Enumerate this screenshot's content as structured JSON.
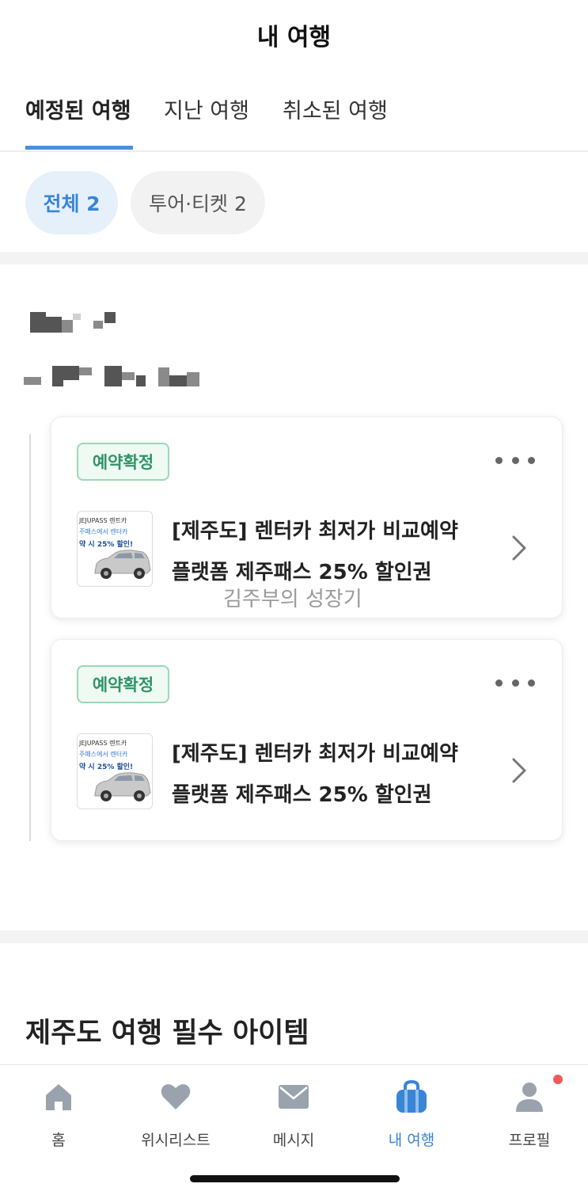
{
  "header": {
    "title": "내 여행"
  },
  "tabs": [
    {
      "label": "예정된 여행",
      "active": true
    },
    {
      "label": "지난 여행",
      "active": false
    },
    {
      "label": "취소된 여행",
      "active": false
    }
  ],
  "filters": [
    {
      "label": "전체 2",
      "active": true
    },
    {
      "label": "투어·티켓 2",
      "active": false
    }
  ],
  "bookings": [
    {
      "status": "예약확정",
      "title_line1": "[제주도] 렌터카 최저가 비교예약",
      "title_line2": "플랫폼 제주패스 25% 할인권",
      "thumb": {
        "brand": "JEJUPASS 렌트카",
        "line1": "주패스에서 렌터카",
        "line2": "약 시 25% 할인!"
      }
    },
    {
      "status": "예약확정",
      "title_line1": "[제주도] 렌터카 최저가 비교예약",
      "title_line2": "플랫폼 제주패스 25% 할인권",
      "thumb": {
        "brand": "JEJUPASS 렌트카",
        "line1": "주패스에서 렌터카",
        "line2": "약 시 25% 할인!"
      }
    }
  ],
  "watermark": "김주부의 성장기",
  "recommend": {
    "title": "제주도 여행 필수 아이템"
  },
  "bottom_nav": [
    {
      "label": "홈",
      "icon": "home-icon"
    },
    {
      "label": "위시리스트",
      "icon": "heart-icon"
    },
    {
      "label": "메시지",
      "icon": "mail-icon"
    },
    {
      "label": "내 여행",
      "icon": "bag-icon",
      "active": true
    },
    {
      "label": "프로필",
      "icon": "person-icon",
      "badge": true
    }
  ],
  "colors": {
    "accent": "#4a90e2",
    "confirmed": "#2f9467",
    "notification": "#ef5b5b"
  }
}
